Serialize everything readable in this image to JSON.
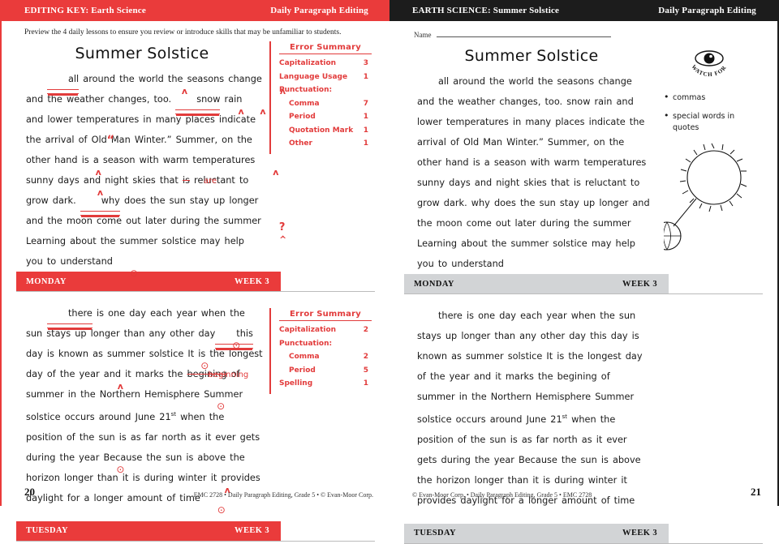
{
  "left_page": {
    "header": {
      "left": "EDITING KEY: Earth Science",
      "right": "Daily Paragraph Editing"
    },
    "subtitle": "Preview the 4 daily lessons to ensure you review or introduce skills that may be unfamiliar to students.",
    "lesson1": {
      "title": "Summer Solstice",
      "text_parts": {
        "t1": "all",
        "t2": " around the world",
        "t3": " the seasons change",
        "t4": " and the weather changes, too. ",
        "t5": "snow",
        "t6": " rain",
        "t7": " and lower temperatures in many places indicate the arrival of ",
        "t8": "Old Man Winter.” Summer, on the other hand",
        "t9": " is a season with warm temperatures",
        "t10": " sunny days",
        "t11": " and night skies that ",
        "t12": "is",
        "t13": " reluctant to grow dark. ",
        "t14": "why",
        "t15": " does the sun stay up longer and the moon come out later during the summer",
        "t16": " Learning about the summer solstice may help you to understand",
        "correction": "are"
      },
      "errors": {
        "heading": "Error Summary",
        "rows": [
          {
            "label": "Capitalization",
            "count": "3",
            "sub": false
          },
          {
            "label": "Language Usage",
            "count": "1",
            "sub": false
          },
          {
            "label": "Punctuation:",
            "count": "",
            "sub": false
          },
          {
            "label": "Comma",
            "count": "7",
            "sub": true
          },
          {
            "label": "Period",
            "count": "1",
            "sub": true
          },
          {
            "label": "Quotation Mark",
            "count": "1",
            "sub": true
          },
          {
            "label": "Other",
            "count": "1",
            "sub": true
          }
        ]
      },
      "banner": {
        "day": "MONDAY",
        "week": "WEEK 3"
      }
    },
    "lesson2": {
      "text_parts": {
        "t1": "there",
        "t2": " is one day each year when the sun stays up longer than any other day",
        "t3": " this",
        "t4": " day is known as summer solstice",
        "t5": " It is the longest day of the year",
        "t6": " and it marks the ",
        "t7": "begining",
        "t8": " of summer in the Northern Hemisphere",
        "t9": " Summer solstice occurs around June 21",
        "sup": "st",
        "t10": " when the position of the sun is as far north as it ever gets during the year",
        "t11": " Because the sun is above the horizon longer than it is during winter",
        "t12": " it provides daylight for a longer amount of time",
        "correction": "beginning"
      },
      "errors": {
        "heading": "Error Summary",
        "rows": [
          {
            "label": "Capitalization",
            "count": "2",
            "sub": false
          },
          {
            "label": "Punctuation:",
            "count": "",
            "sub": false
          },
          {
            "label": "Comma",
            "count": "2",
            "sub": true
          },
          {
            "label": "Period",
            "count": "5",
            "sub": true
          },
          {
            "label": "Spelling",
            "count": "1",
            "sub": false
          }
        ]
      },
      "banner": {
        "day": "TUESDAY",
        "week": "WEEK 3"
      }
    },
    "footer": {
      "page": "20",
      "credit": "EMC 2728 • Daily Paragraph Editing, Grade 5 • © Evan-Moor Corp."
    }
  },
  "right_page": {
    "header": {
      "left": "EARTH SCIENCE: Summer Solstice",
      "right": "Daily Paragraph Editing"
    },
    "name_label": "Name",
    "lesson1": {
      "title": "Summer Solstice",
      "body": "all around the world the seasons change and the weather changes, too. snow rain and lower temperatures in many places indicate the arrival of Old Man Winter.” Summer, on the other hand is a season with warm temperatures sunny days and night skies that is reluctant to grow dark. why does the sun stay up longer and the moon come out later during the summer Learning about the summer solstice may help you to understand",
      "banner": {
        "day": "MONDAY",
        "week": "WEEK 3"
      },
      "watch": {
        "badge": "WATCH FOR",
        "items": [
          "commas",
          "special words in quotes"
        ]
      }
    },
    "lesson2": {
      "body_a": "there is one day each year when the sun stays up longer than any other day this day is known as summer solstice It is the longest day of the year and it marks the begining of summer in the Northern Hemisphere Summer solstice occurs around June 21",
      "sup": "st",
      "body_b": " when the position of the sun is as far north as it ever gets during the year Because the sun is above the horizon longer than it is during winter it provides daylight for a longer amount of time",
      "banner": {
        "day": "TUESDAY",
        "week": "WEEK 3"
      }
    },
    "footer": {
      "page": "21",
      "credit": "© Evan-Moor Corp. • Daily Paragraph Editing, Grade 5 • EMC 2728"
    }
  },
  "colors": {
    "accent_red": "#ea3b3b",
    "mark_red": "#e23b3b",
    "header_dark": "#1c1c1c",
    "banner_gray": "#d2d4d6"
  }
}
